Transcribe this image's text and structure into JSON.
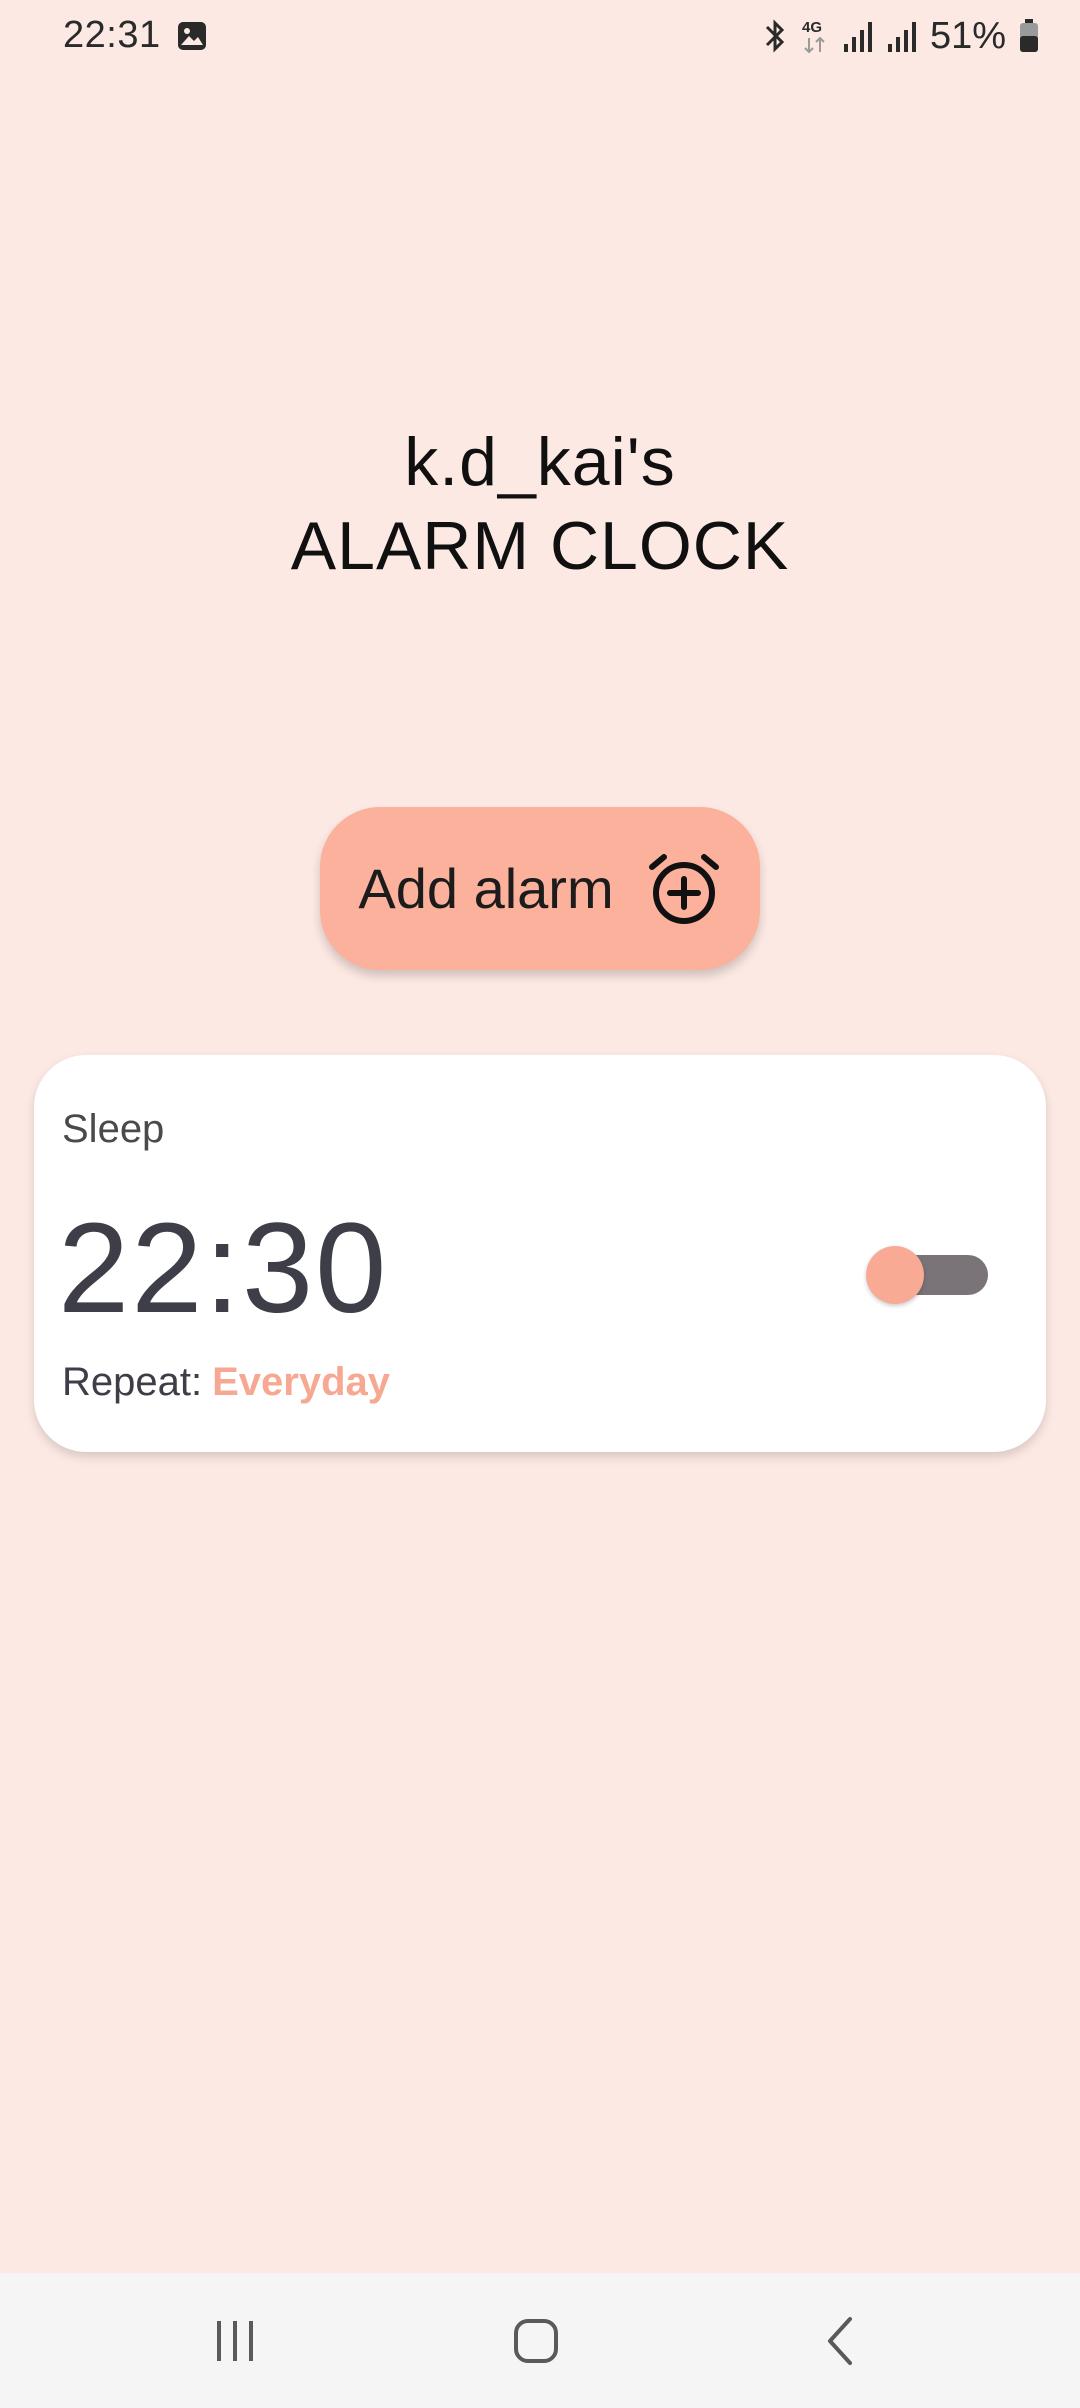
{
  "status_bar": {
    "time": "22:31",
    "battery": "51%",
    "icons": [
      "gallery-icon",
      "bluetooth-icon",
      "4g-icon",
      "signal-icon",
      "signal-icon",
      "battery-icon"
    ]
  },
  "title": {
    "line1": "k.d_kai's",
    "line2": "ALARM CLOCK"
  },
  "add_button": {
    "label": "Add alarm",
    "icon": "alarm-add-icon"
  },
  "alarms": [
    {
      "name": "Sleep",
      "time": "22:30",
      "repeat_label": "Repeat:",
      "repeat_value": "Everyday",
      "enabled": false
    }
  ],
  "nav_bar": {
    "buttons": [
      "recent-apps-icon",
      "home-icon",
      "back-icon"
    ]
  },
  "colors": {
    "background": "#fde9e4",
    "accent": "#fbb19c",
    "card": "#ffffff",
    "toggle_track": "#7a7378"
  }
}
